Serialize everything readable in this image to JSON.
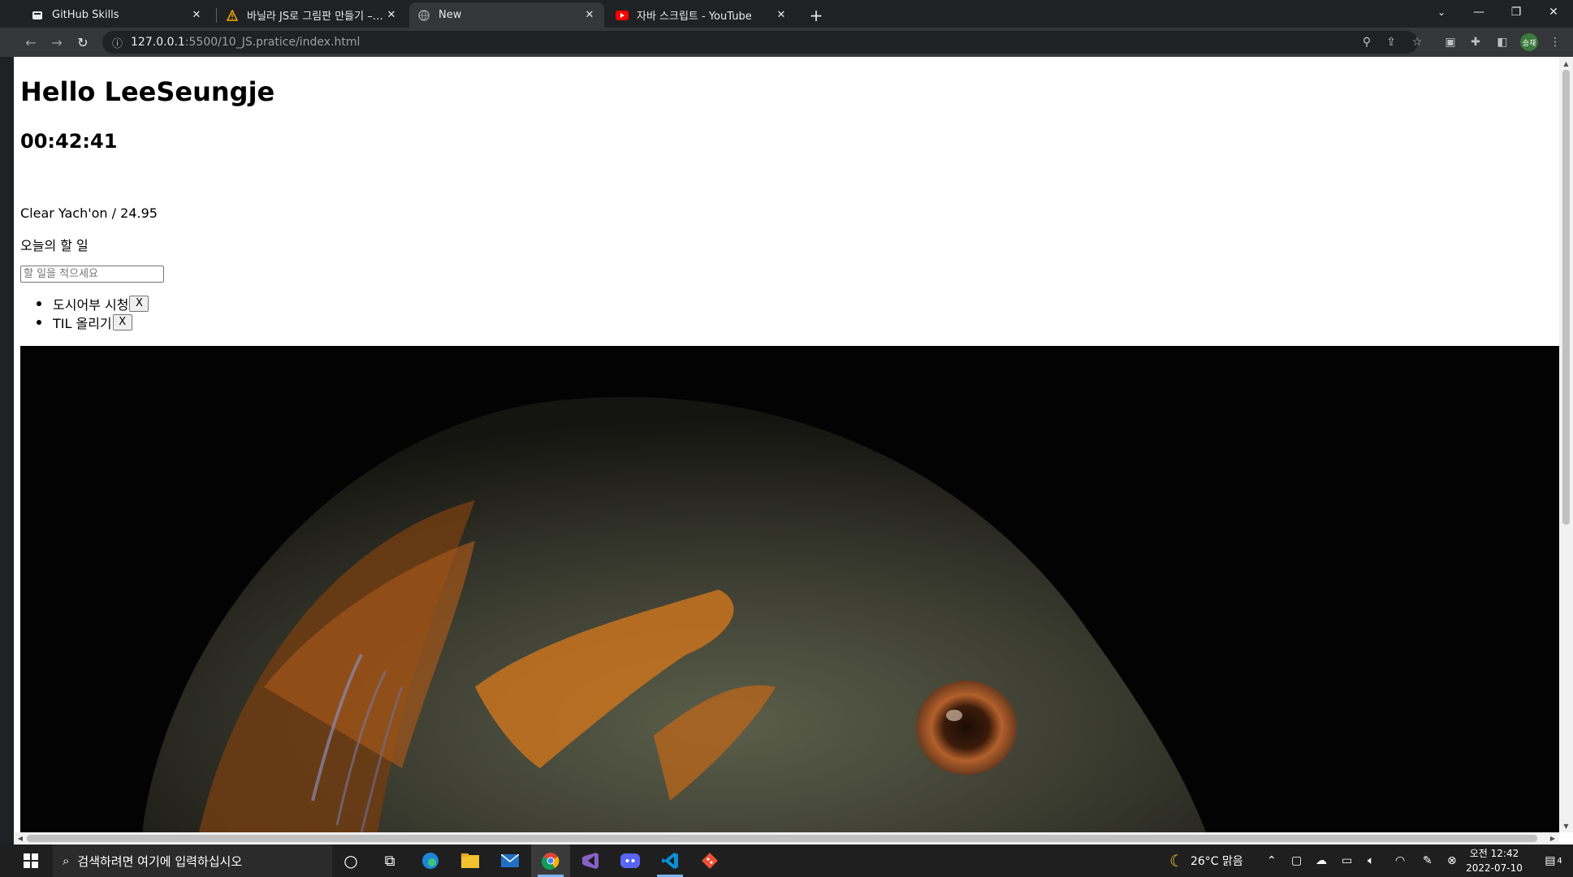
{
  "browser": {
    "tabs": [
      {
        "title": "GitHub Skills",
        "icon": "github-icon"
      },
      {
        "title": "바닐라 JS로 그림판 만들기 – 노마드",
        "icon": "warning-icon"
      },
      {
        "title": "New",
        "icon": "globe-icon",
        "active": true
      },
      {
        "title": "자바 스크립트 - YouTube",
        "icon": "youtube-icon"
      }
    ],
    "new_tab_label": "+",
    "url_host": "127.0.0.1",
    "url_path": ":5500/10_JS.pratice/index.html",
    "profile_label": "승재"
  },
  "page": {
    "greeting": "Hello LeeSeungje",
    "clock": "00:42:41",
    "weather": "Clear Yach'on / 24.95",
    "todo_title": "오늘의 할 일",
    "todo_placeholder": "할 일을 적으세요",
    "todos": [
      {
        "text": "도시어부 시청",
        "delete_label": "X"
      },
      {
        "text": "TIL 올리기",
        "delete_label": "X"
      }
    ]
  },
  "taskbar": {
    "search_placeholder": "검색하려면 여기에 입력하십시오",
    "weather": "26°C 맑음",
    "time": "오전 12:42",
    "date": "2022-07-10",
    "notification_count": "4"
  },
  "colors": {
    "tab_strip": "#202124",
    "active_tab": "#35363a",
    "taskbar": "#1f1f1f",
    "fish_orange": "#c8731e"
  }
}
